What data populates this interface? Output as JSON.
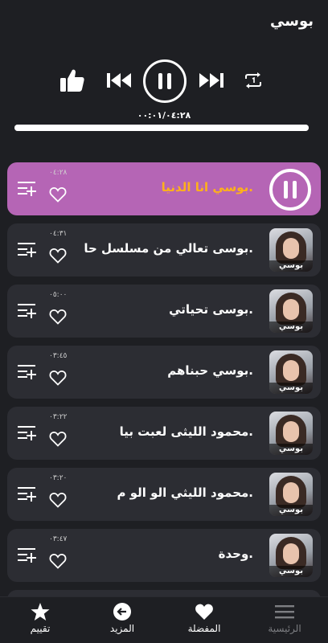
{
  "header": {
    "title": "بوسي"
  },
  "player": {
    "time_readout": "٠٠:٠١/٠٤:٢٨",
    "progress_fraction": 1.0
  },
  "songs": [
    {
      "title": ".بوسي انا الدنيا",
      "duration": "٠٤:٢٨",
      "active": true
    },
    {
      "title": ".بوسى تعالي من مسلسل حا",
      "duration": "٠٤:٣١",
      "thumb_caption": "بوسي"
    },
    {
      "title": ".بوسى تحياتي",
      "duration": "٠٥:٠٠",
      "thumb_caption": "بوسي"
    },
    {
      "title": ".بوسي حبناهم",
      "duration": "٠٣:٤٥",
      "thumb_caption": "بوسي"
    },
    {
      "title": ".محمود الليثى لعبت بيا",
      "duration": "٠٣:٢٢",
      "thumb_caption": "بوسي"
    },
    {
      "title": ".محمود الليثي الو الو م",
      "duration": "٠٣:٢٠",
      "thumb_caption": "بوسي"
    },
    {
      "title": ".وحدة",
      "duration": "٠٣:٤٧",
      "thumb_caption": "بوسي"
    }
  ],
  "bottom_nav": {
    "home": "الرئيسية",
    "favorites": "المفضلة",
    "more": "المزيد",
    "rate": "تقييم"
  },
  "colors": {
    "background": "#1e1f23",
    "card": "#2c2d33",
    "active_card": "#b565b5",
    "active_title": "#ffb11a"
  },
  "icons": [
    "thumbs-up-icon",
    "previous-icon",
    "pause-icon",
    "next-icon",
    "repeat-one-icon",
    "heart-outline-icon",
    "add-to-queue-icon",
    "menu-icon",
    "heart-filled-icon",
    "arrow-left-circle-icon",
    "star-icon"
  ]
}
